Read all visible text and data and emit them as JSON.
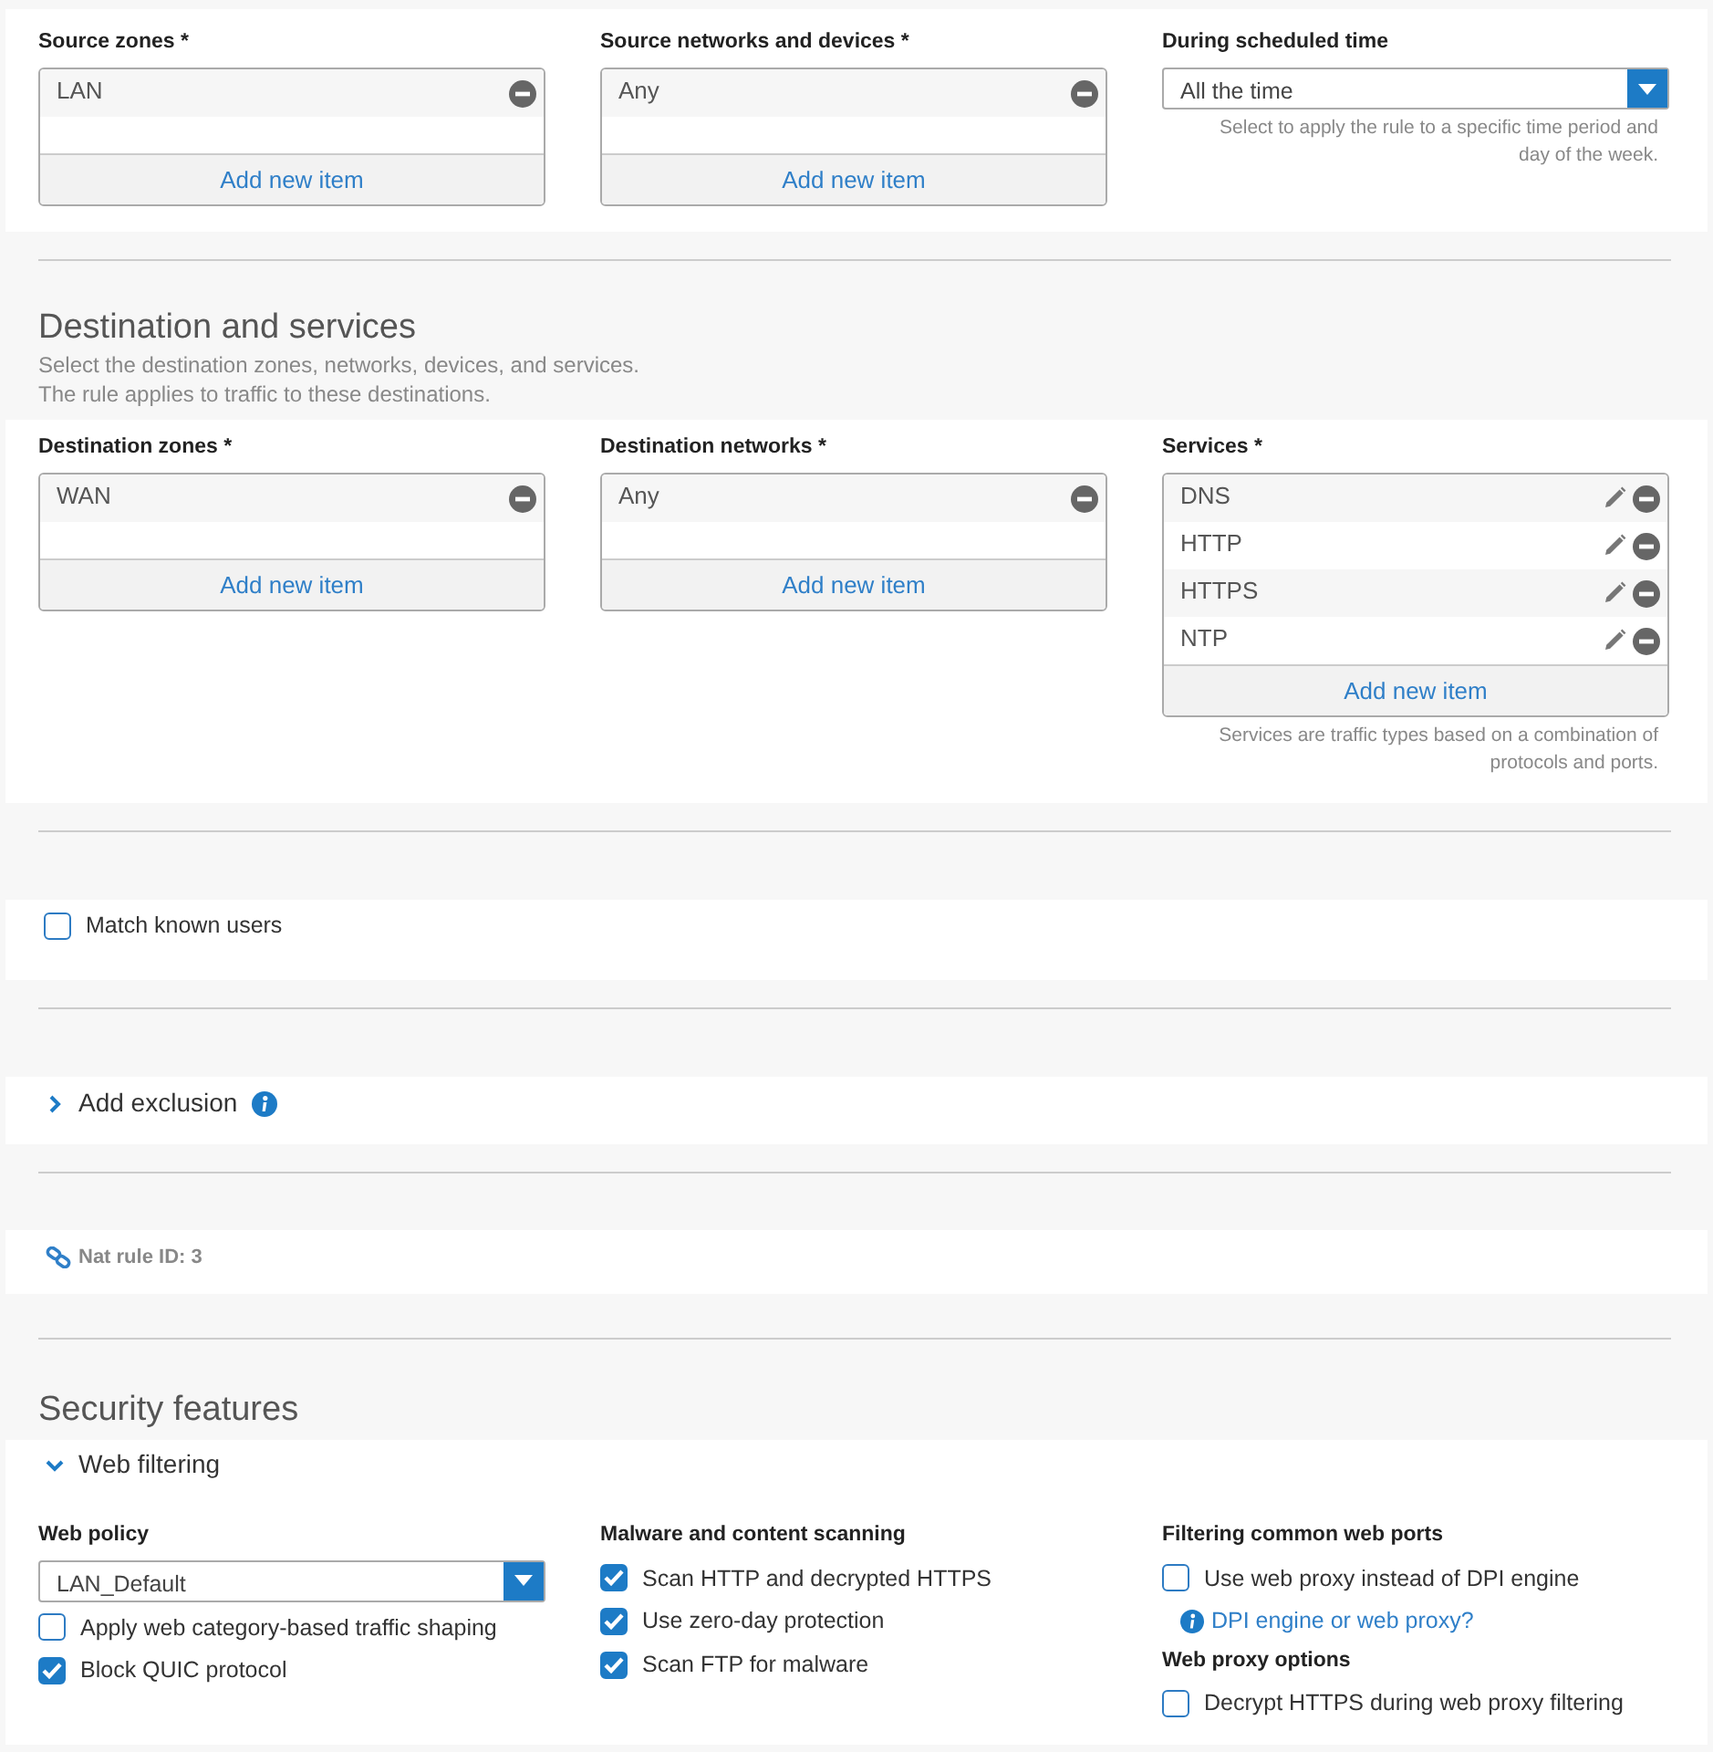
{
  "source_row": {
    "columns": [
      {
        "kind": "list",
        "label": "Source zones *",
        "items": [
          {
            "text": "LAN",
            "editable": false
          }
        ],
        "add": "Add new item"
      },
      {
        "kind": "list",
        "label": "Source networks and devices *",
        "items": [
          {
            "text": "Any",
            "editable": false
          }
        ],
        "add": "Add new item"
      },
      {
        "kind": "select",
        "label": "During scheduled time",
        "value": "All the time",
        "help": "Select to apply the rule to a specific time period and day of the week."
      }
    ]
  },
  "destination": {
    "title": "Destination and services",
    "description": [
      "Select the destination zones, networks, devices, and services.",
      "The rule applies to traffic to these destinations."
    ],
    "columns": [
      {
        "kind": "list",
        "label": "Destination zones *",
        "items": [
          {
            "text": "WAN",
            "editable": false
          }
        ],
        "add": "Add new item"
      },
      {
        "kind": "list",
        "label": "Destination networks *",
        "items": [
          {
            "text": "Any",
            "editable": false
          }
        ],
        "add": "Add new item"
      },
      {
        "kind": "list",
        "label": "Services *",
        "items": [
          {
            "text": "DNS",
            "editable": true
          },
          {
            "text": "HTTP",
            "editable": true
          },
          {
            "text": "HTTPS",
            "editable": true
          },
          {
            "text": "NTP",
            "editable": true
          }
        ],
        "add": "Add new item",
        "help": "Services are traffic types based on a combination of protocols and ports."
      }
    ]
  },
  "match_known_users": {
    "label": "Match known users",
    "checked": false
  },
  "exclusion": {
    "label": "Add exclusion",
    "expanded": false
  },
  "nat_rule": {
    "text": "Nat rule ID: 3"
  },
  "security": {
    "title": "Security features",
    "web_filtering": {
      "label": "Web filtering",
      "expanded": true,
      "columns": [
        [
          {
            "kind": "heading",
            "text": "Web policy"
          },
          {
            "kind": "select",
            "value": "LAN_Default"
          },
          {
            "kind": "checkbox",
            "text": "Apply web category-based traffic shaping",
            "checked": false
          },
          {
            "kind": "checkbox",
            "text": "Block QUIC protocol",
            "checked": true
          }
        ],
        [
          {
            "kind": "heading",
            "text": "Malware and content scanning"
          },
          {
            "kind": "checkbox",
            "text": "Scan HTTP and decrypted HTTPS",
            "checked": true
          },
          {
            "kind": "checkbox",
            "text": "Use zero-day protection",
            "checked": true
          },
          {
            "kind": "checkbox",
            "text": "Scan FTP for malware",
            "checked": true
          }
        ],
        [
          {
            "kind": "heading",
            "text": "Filtering common web ports"
          },
          {
            "kind": "checkbox",
            "text": "Use web proxy instead of DPI engine",
            "checked": false
          },
          {
            "kind": "link",
            "text": "DPI engine or web proxy?"
          },
          {
            "kind": "heading",
            "text": "Web proxy options"
          },
          {
            "kind": "checkbox",
            "text": "Decrypt HTTPS during web proxy filtering",
            "checked": false
          }
        ]
      ]
    }
  }
}
